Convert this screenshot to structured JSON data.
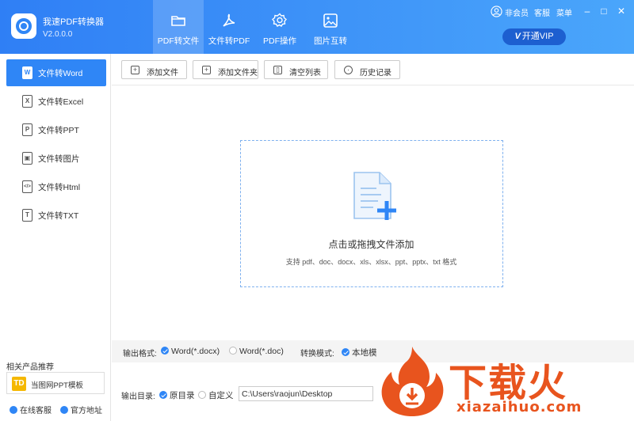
{
  "app": {
    "title": "我速PDF转换器",
    "version": "V2.0.0.0"
  },
  "nav_tabs": [
    {
      "label": "PDF转文件",
      "icon": "folder-icon",
      "active": true
    },
    {
      "label": "文件转PDF",
      "icon": "pdf-icon",
      "active": false
    },
    {
      "label": "PDF操作",
      "icon": "gear-icon",
      "active": false
    },
    {
      "label": "图片互转",
      "icon": "image-icon",
      "active": false
    }
  ],
  "header_right": {
    "member": "非会员",
    "service": "客服",
    "menu": "菜单",
    "vip_label": "开通VIP",
    "vip_icon_text": "V"
  },
  "sidebar": {
    "items": [
      {
        "label": "文件转Word",
        "icon_text": "W",
        "active": true
      },
      {
        "label": "文件转Excel",
        "icon_text": "X",
        "active": false
      },
      {
        "label": "文件转PPT",
        "icon_text": "P",
        "active": false
      },
      {
        "label": "文件转图片",
        "icon_text": "▣",
        "active": false
      },
      {
        "label": "文件转Html",
        "icon_text": "</>",
        "active": false
      },
      {
        "label": "文件转TXT",
        "icon_text": "T",
        "active": false
      }
    ],
    "recommend_title": "相关产品推荐",
    "recommend_item": "当图网PPT模板",
    "recommend_logo": "TD",
    "online_service": "在线客服",
    "official_site": "官方地址"
  },
  "toolbar": {
    "add_file": "添加文件",
    "add_folder": "添加文件夹",
    "clear_list": "清空列表",
    "history": "历史记录"
  },
  "dropzone": {
    "title": "点击或拖拽文件添加",
    "hint": "支持 pdf、doc、docx、xls、xlsx、ppt、pptx、txt 格式"
  },
  "output_format": {
    "label": "输出格式:",
    "options": [
      "Word(*.docx)",
      "Word(*.doc)"
    ],
    "selected": "Word(*.docx)",
    "mode_label": "转换模式:",
    "mode_option": "本地模"
  },
  "output_dir": {
    "label": "输出目录:",
    "original": "原目录",
    "custom": "自定义",
    "path": "C:\\Users\\raojun\\Desktop"
  },
  "watermark": {
    "text": "下载火",
    "url": "xiazaihuo.com"
  },
  "colors": {
    "header": "#3d92f8",
    "accent": "#2f86f6",
    "watermark": "#e8541e"
  }
}
